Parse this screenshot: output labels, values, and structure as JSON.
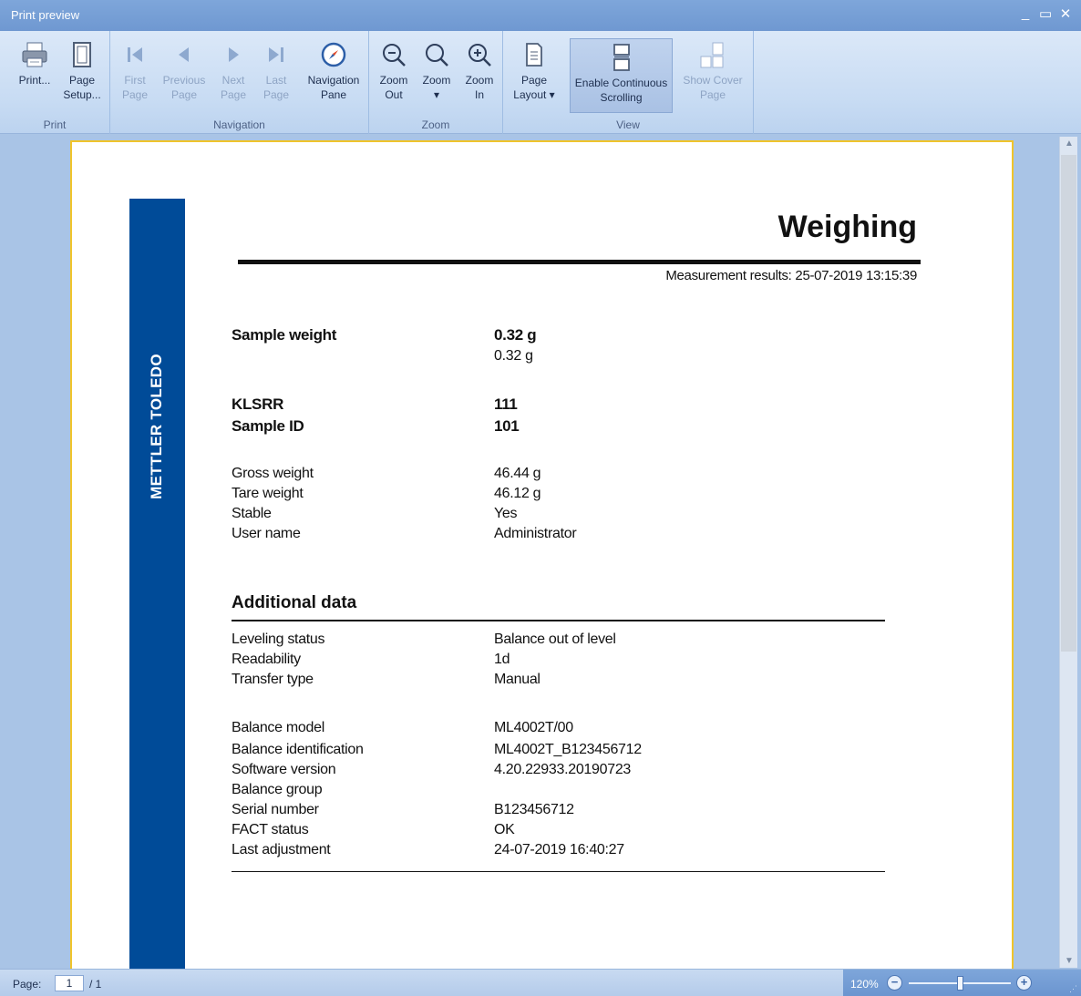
{
  "window": {
    "title": "Print preview"
  },
  "ribbon": {
    "groups": {
      "print": "Print",
      "navigation": "Navigation",
      "zoom": "Zoom",
      "view": "View"
    },
    "buttons": {
      "print": "Print...",
      "page_setup": "Page\nSetup...",
      "first_page": "First\nPage",
      "previous_page": "Previous\nPage",
      "next_page": "Next\nPage",
      "last_page": "Last\nPage",
      "navigation_pane": "Navigation\nPane",
      "zoom_out": "Zoom\nOut",
      "zoom": "Zoom\n▾",
      "zoom_in": "Zoom\nIn",
      "page_layout": "Page\nLayout ▾",
      "enable_continuous_scrolling": "Enable Continuous\nScrolling",
      "show_cover_page": "Show Cover\nPage"
    }
  },
  "report": {
    "brand": "METTLER TOLEDO",
    "title": "Weighing",
    "measurement": "Measurement results: 25-07-2019 13:15:39",
    "sample_weight_label": "Sample weight",
    "sample_weight_value": "0.32 g",
    "sample_weight_value2": "0.32 g",
    "klsrr_label": "KLSRR",
    "klsrr_value": "111",
    "sample_id_label": "Sample ID",
    "sample_id_value": "101",
    "details": [
      {
        "k": "Gross weight",
        "v": "46.44 g"
      },
      {
        "k": "Tare weight",
        "v": "46.12 g"
      },
      {
        "k": "Stable",
        "v": "Yes"
      },
      {
        "k": "User name",
        "v": "Administrator"
      }
    ],
    "additional_title": "Additional data",
    "additional": [
      {
        "k": "Leveling status",
        "v": "Balance out of level"
      },
      {
        "k": "Readability",
        "v": "1d"
      },
      {
        "k": "Transfer type",
        "v": "Manual"
      }
    ],
    "balance": [
      {
        "k": "Balance model",
        "v": "ML4002T/00"
      },
      {
        "k": "Balance identification",
        "v": "ML4002T_B123456712"
      },
      {
        "k": "Software version",
        "v": "4.20.22933.20190723"
      },
      {
        "k": "Balance group",
        "v": ""
      },
      {
        "k": "Serial number",
        "v": "B123456712"
      },
      {
        "k": "FACT status",
        "v": "OK"
      },
      {
        "k": "Last adjustment",
        "v": "24-07-2019 16:40:27"
      }
    ]
  },
  "status": {
    "page_label": "Page:",
    "page_value": "1",
    "page_total": "/ 1",
    "zoom_level": "120%"
  },
  "colors": {
    "brand_blue": "#004b98",
    "page_border": "#f0c42b",
    "ribbon_bg": "#c7dbf3"
  }
}
